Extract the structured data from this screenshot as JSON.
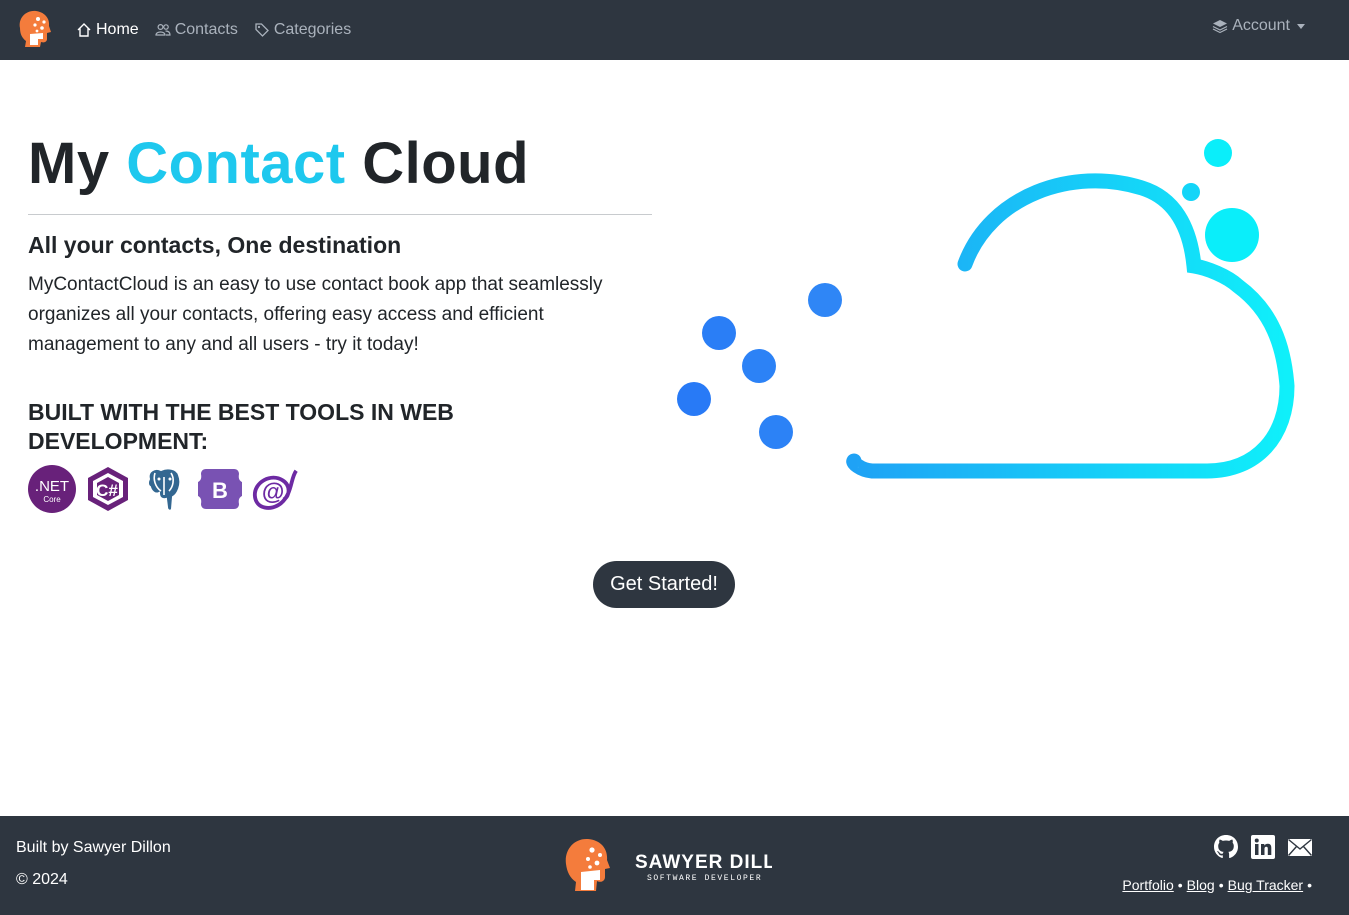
{
  "nav": {
    "brand_icon": "developer-head-logo-icon",
    "items": [
      {
        "label": "Home",
        "icon": "home-icon",
        "active": true
      },
      {
        "label": "Contacts",
        "icon": "people-icon",
        "active": false
      },
      {
        "label": "Categories",
        "icon": "tags-icon",
        "active": false
      }
    ],
    "account": {
      "label": "Account",
      "icon": "layers-icon"
    }
  },
  "hero": {
    "title_part1": "My",
    "title_accent": "Contact",
    "title_part2": "Cloud",
    "accent_color": "#1ec8ee",
    "tagline": "All your contacts, One destination",
    "description": "MyContactCloud is an easy to use contact book app that seamlessly organizes all your contacts, offering easy access and efficient management to any and all users - try it today!",
    "tools_heading": "BUILT WITH THE BEST TOOLS IN WEB DEVELOPMENT:",
    "tools": [
      {
        "icon": "dotnet-core-icon",
        "text": ".NET",
        "subtext": "Core"
      },
      {
        "icon": "csharp-icon",
        "text": "C#"
      },
      {
        "icon": "postgresql-icon"
      },
      {
        "icon": "bootstrap-icon",
        "text": "B"
      },
      {
        "icon": "blazor-icon",
        "text": "@"
      }
    ],
    "illustration_icon": "cloud-speed-icon",
    "cta_label": "Get Started!"
  },
  "footer": {
    "built_by": "Built by Sawyer Dillon",
    "copyright": "© 2024",
    "logo_name": "SAWYER DILLON",
    "logo_subtitle": "SOFTWARE DEVELOPER",
    "social": [
      "github-icon",
      "linkedin-icon",
      "mail-icon"
    ],
    "links": [
      "Portfolio",
      "Blog",
      "Bug Tracker"
    ]
  },
  "colors": {
    "navbar_bg": "#2e3640",
    "accent": "#1ec8ee",
    "brand_orange": "#f47c3c",
    "tool_purple": "#68217a"
  }
}
